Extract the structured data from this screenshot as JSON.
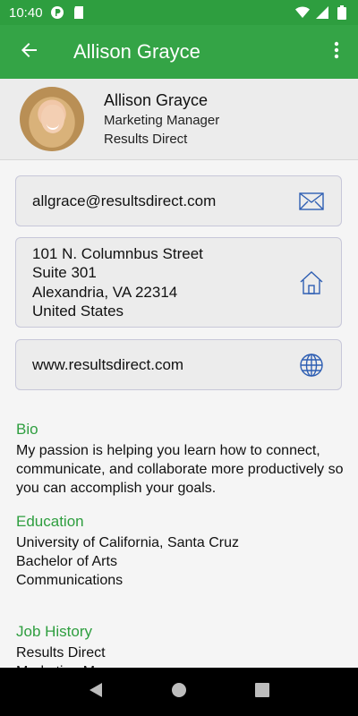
{
  "status_bar": {
    "time": "10:40",
    "icons": [
      "notification-app-icon",
      "sd-card-icon",
      "wifi-icon",
      "signal-icon",
      "battery-icon"
    ]
  },
  "app_bar": {
    "title": "Allison Grayce",
    "back_icon": "back-arrow-icon",
    "menu_icon": "more-vert-icon",
    "color": "#34a446"
  },
  "profile": {
    "name": "Allison Grayce",
    "title": "Marketing Manager",
    "company": "Results Direct"
  },
  "contact": {
    "email": "allgrace@resultsdirect.com",
    "address_lines": [
      "101 N. Columnbus Street",
      "Suite 301",
      "Alexandria, VA 22314",
      "United States"
    ],
    "website": "www.resultsdirect.com"
  },
  "bio": {
    "title": "Bio",
    "text": "My passion is helping you learn how to connect, communicate, and collaborate more productively so you can accomplish your goals."
  },
  "education": {
    "title": "Education",
    "lines": [
      "University of California, Santa Cruz",
      "Bachelor of Arts",
      "Communications"
    ]
  },
  "job_history": {
    "title": "Job History",
    "lines": [
      "Results Direct",
      "Marketing Manager"
    ]
  },
  "nav_bar": {
    "icons": [
      "back-triangle-icon",
      "home-circle-icon",
      "recents-square-icon"
    ]
  }
}
